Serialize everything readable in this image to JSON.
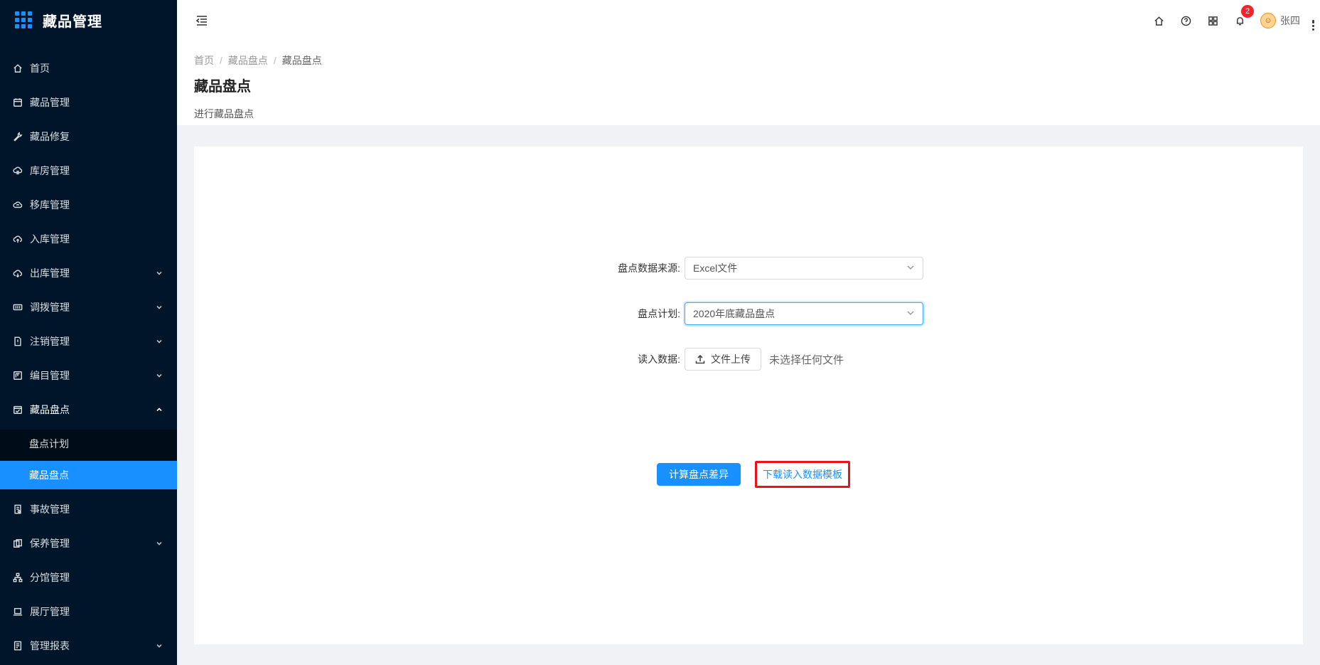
{
  "app": {
    "title": "藏品管理"
  },
  "sidebar": {
    "items": [
      {
        "label": "首页",
        "icon": "home-icon",
        "has_arrow": false
      },
      {
        "label": "藏品管理",
        "icon": "calendar-icon",
        "has_arrow": false
      },
      {
        "label": "藏品修复",
        "icon": "wrench-icon",
        "has_arrow": false
      },
      {
        "label": "库房管理",
        "icon": "warehouse-icon",
        "has_arrow": false
      },
      {
        "label": "移库管理",
        "icon": "cloud-sync-icon",
        "has_arrow": false
      },
      {
        "label": "入库管理",
        "icon": "cloud-upload-icon",
        "has_arrow": false
      },
      {
        "label": "出库管理",
        "icon": "cloud-download-icon",
        "has_arrow": true
      },
      {
        "label": "调拨管理",
        "icon": "transfer-icon",
        "has_arrow": true
      },
      {
        "label": "注销管理",
        "icon": "file-icon",
        "has_arrow": true
      },
      {
        "label": "编目管理",
        "icon": "catalog-icon",
        "has_arrow": true
      },
      {
        "label": "藏品盘点",
        "icon": "inventory-icon",
        "has_arrow": true,
        "open": true
      },
      {
        "label": "事故管理",
        "icon": "accident-icon",
        "has_arrow": false
      },
      {
        "label": "保养管理",
        "icon": "maintenance-icon",
        "has_arrow": true
      },
      {
        "label": "分馆管理",
        "icon": "branch-icon",
        "has_arrow": false
      },
      {
        "label": "展厅管理",
        "icon": "laptop-icon",
        "has_arrow": false
      },
      {
        "label": "管理报表",
        "icon": "report-icon",
        "has_arrow": true
      }
    ],
    "submenu": [
      {
        "label": "盘点计划",
        "active": false
      },
      {
        "label": "藏品盘点",
        "active": true
      }
    ]
  },
  "header": {
    "notification_count": "2",
    "user_name": "张四"
  },
  "breadcrumb": [
    "首页",
    "藏品盘点",
    "藏品盘点"
  ],
  "page": {
    "title": "藏品盘点",
    "description": "进行藏品盘点"
  },
  "form": {
    "source_label": "盘点数据来源:",
    "source_value": "Excel文件",
    "plan_label": "盘点计划:",
    "plan_value": "2020年底藏品盘点",
    "read_label": "读入数据:",
    "upload_label": "文件上传",
    "upload_hint": "未选择任何文件"
  },
  "actions": {
    "calculate_label": "计算盘点差异",
    "download_label": "下载读入数据模板"
  },
  "colors": {
    "sidebar_bg": "#001529",
    "accent": "#1890ff",
    "highlight_border": "#e8141b",
    "badge": "#f5222d"
  }
}
